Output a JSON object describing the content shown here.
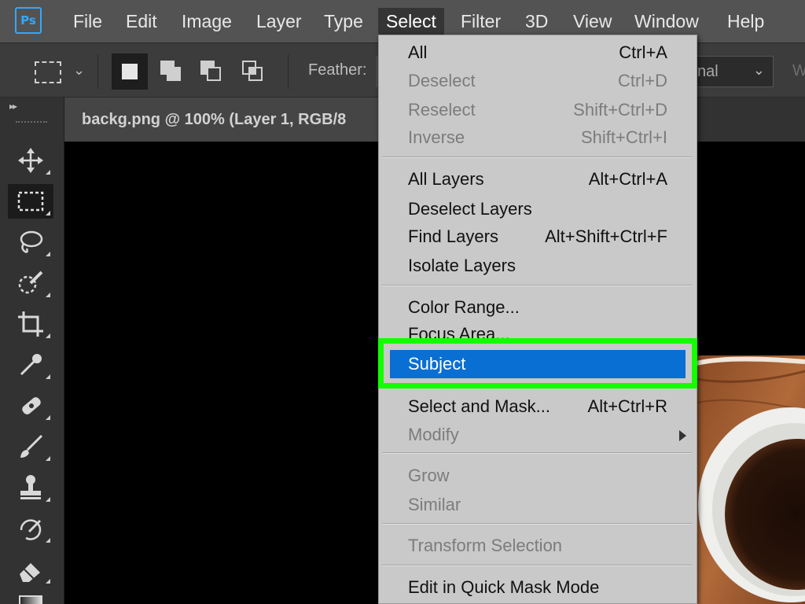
{
  "app": {
    "logo_text": "Ps"
  },
  "menubar": {
    "items": [
      "File",
      "Edit",
      "Image",
      "Layer",
      "Type",
      "Select",
      "Filter",
      "3D",
      "View",
      "Window",
      "Help"
    ],
    "active": "Select"
  },
  "options_bar": {
    "feather_label": "Feather:",
    "style_value": "nal",
    "width_label_partial": "W"
  },
  "document": {
    "tab_title": "backg.png @ 100% (Layer 1, RGB/8"
  },
  "select_menu": {
    "groups": [
      [
        {
          "label": "All",
          "shortcut": "Ctrl+A",
          "enabled": true
        },
        {
          "label": "Deselect",
          "shortcut": "Ctrl+D",
          "enabled": false
        },
        {
          "label": "Reselect",
          "shortcut": "Shift+Ctrl+D",
          "enabled": false
        },
        {
          "label": "Inverse",
          "shortcut": "Shift+Ctrl+I",
          "enabled": false
        }
      ],
      [
        {
          "label": "All Layers",
          "shortcut": "Alt+Ctrl+A",
          "enabled": true
        },
        {
          "label": "Deselect Layers",
          "shortcut": "",
          "enabled": true
        },
        {
          "label": "Find Layers",
          "shortcut": "Alt+Shift+Ctrl+F",
          "enabled": true
        },
        {
          "label": "Isolate Layers",
          "shortcut": "",
          "enabled": true
        }
      ],
      [
        {
          "label": "Color Range...",
          "shortcut": "",
          "enabled": true
        },
        {
          "label": "Focus Area...",
          "shortcut": "",
          "enabled": true
        },
        {
          "label": "Subject",
          "shortcut": "",
          "enabled": true,
          "highlighted": true
        }
      ],
      [
        {
          "label": "Select and Mask...",
          "shortcut": "Alt+Ctrl+R",
          "enabled": true
        },
        {
          "label": "Modify",
          "shortcut": "",
          "enabled": false,
          "submenu": true
        }
      ],
      [
        {
          "label": "Grow",
          "shortcut": "",
          "enabled": false
        },
        {
          "label": "Similar",
          "shortcut": "",
          "enabled": false
        }
      ],
      [
        {
          "label": "Transform Selection",
          "shortcut": "",
          "enabled": false
        }
      ],
      [
        {
          "label": "Edit in Quick Mask Mode",
          "shortcut": "",
          "enabled": true
        }
      ]
    ]
  },
  "tools": [
    {
      "name": "move-tool-icon",
      "selected": false
    },
    {
      "name": "rectangular-marquee-tool-icon",
      "selected": true
    },
    {
      "name": "lasso-tool-icon",
      "selected": false
    },
    {
      "name": "quick-selection-tool-icon",
      "selected": false
    },
    {
      "name": "crop-tool-icon",
      "selected": false
    },
    {
      "name": "eyedropper-tool-icon",
      "selected": false
    },
    {
      "name": "spot-healing-brush-icon",
      "selected": false
    },
    {
      "name": "brush-tool-icon",
      "selected": false
    },
    {
      "name": "clone-stamp-tool-icon",
      "selected": false
    },
    {
      "name": "history-brush-icon",
      "selected": false
    },
    {
      "name": "eraser-tool-icon",
      "selected": false
    },
    {
      "name": "gradient-tool-icon",
      "selected": false
    }
  ],
  "colors": {
    "highlight_box": "#12ff00",
    "menu_highlight": "#0a6fd3",
    "menu_bg": "#c9c9c9",
    "ps_blue": "#31a8ff"
  }
}
